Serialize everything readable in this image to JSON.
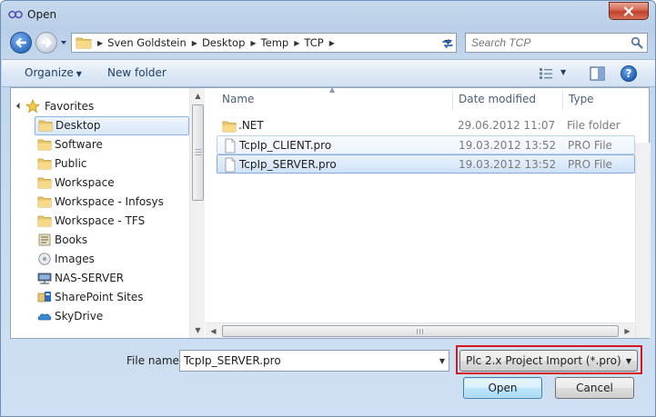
{
  "window": {
    "title": "Open",
    "close_glyph": "✕"
  },
  "address": {
    "breadcrumbs": [
      "Sven Goldstein",
      "Desktop",
      "Temp",
      "TCP"
    ],
    "search_placeholder": "Search TCP"
  },
  "toolbar": {
    "organize_label": "Organize",
    "new_folder_label": "New folder",
    "help_label": "?"
  },
  "sidebar": {
    "header": "Favorites",
    "items": [
      {
        "label": "Desktop",
        "icon": "folder-icon",
        "selected": true
      },
      {
        "label": "Software",
        "icon": "folder-icon"
      },
      {
        "label": "Public",
        "icon": "folder-icon"
      },
      {
        "label": "Workspace",
        "icon": "folder-icon"
      },
      {
        "label": "Workspace - Infosys",
        "icon": "folder-icon"
      },
      {
        "label": "Workspace - TFS",
        "icon": "folder-icon"
      },
      {
        "label": "Books",
        "icon": "library-icon"
      },
      {
        "label": "Images",
        "icon": "images-icon"
      },
      {
        "label": "NAS-SERVER",
        "icon": "network-drive-icon"
      },
      {
        "label": "SharePoint Sites",
        "icon": "sharepoint-icon"
      },
      {
        "label": "SkyDrive",
        "icon": "skydrive-icon"
      }
    ]
  },
  "files": {
    "columns": [
      "Name",
      "Date modified",
      "Type"
    ],
    "rows": [
      {
        "name": ".NET",
        "date": "29.06.2012 11:07",
        "type": "File folder",
        "icon": "folder-icon"
      },
      {
        "name": "TcpIp_CLIENT.pro",
        "date": "19.03.2012 13:52",
        "type": "PRO File",
        "icon": "file-icon"
      },
      {
        "name": "TcpIp_SERVER.pro",
        "date": "19.03.2012 13:52",
        "type": "PRO File",
        "icon": "file-icon",
        "selected": true
      }
    ]
  },
  "footer": {
    "file_name_label": "File name:",
    "file_name_value": "TcpIp_SERVER.pro",
    "filter_value": "Plc 2.x Project Import (*.pro)",
    "open_label": "Open",
    "cancel_label": "Cancel"
  },
  "colors": {
    "highlight_border": "#d9181e",
    "selection_border": "#84acdd"
  }
}
